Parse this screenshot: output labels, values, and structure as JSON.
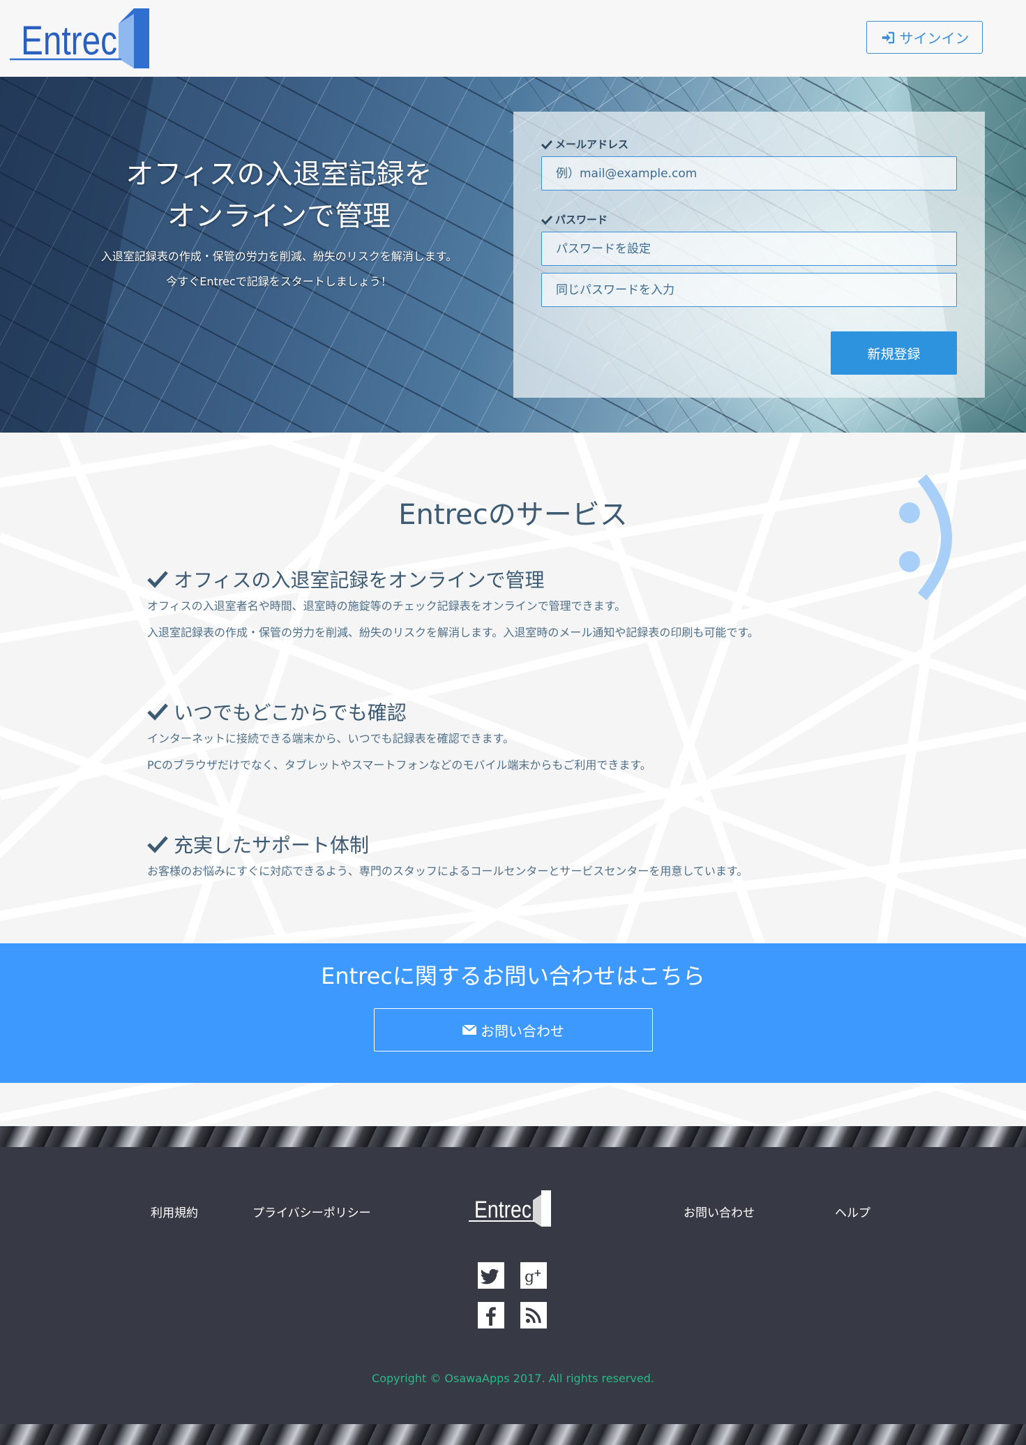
{
  "header": {
    "logo_text": "Entrec",
    "signin_label": "サインイン"
  },
  "hero": {
    "title_line1": "オフィスの入退室記録を",
    "title_line2": "オンラインで管理",
    "subtitle_line1": "入退室記録表の作成・保管の労力を削減、紛失のリスクを解消します。",
    "subtitle_line2": "今すぐEntrecで記録をスタートしましょう！"
  },
  "signup_form": {
    "email_label": "メールアドレス",
    "email_placeholder": "例）mail@example.com",
    "password_label": "パスワード",
    "password_placeholder": "パスワードを設定",
    "password_confirm_placeholder": "同じパスワードを入力",
    "register_label": "新規登録"
  },
  "services": {
    "title": "Entrecのサービス",
    "features": [
      {
        "heading": "オフィスの入退室記録をオンラインで管理",
        "lines": [
          "オフィスの入退室者名や時間、退室時の施錠等のチェック記録表をオンラインで管理できます。",
          "入退室記録表の作成・保管の労力を削減、紛失のリスクを解消します。入退室時のメール通知や記録表の印刷も可能です。"
        ]
      },
      {
        "heading": "いつでもどこからでも確認",
        "lines": [
          "インターネットに接続できる端末から、いつでも記録表を確認できます。",
          "PCのブラウザだけでなく、タブレットやスマートフォンなどのモバイル端末からもご利用できます。"
        ]
      },
      {
        "heading": "充実したサポート体制",
        "lines": [
          "お客様のお悩みにすぐに対応できるよう、専門のスタッフによるコールセンターとサービスセンターを用意しています。"
        ]
      }
    ]
  },
  "contact": {
    "title": "Entrecに関するお問い合わせはこちら",
    "button_label": "お問い合わせ"
  },
  "footer": {
    "links": {
      "terms": "利用規約",
      "privacy": "プライバシーポリシー",
      "contact": "お問い合わせ",
      "help": "ヘルプ"
    },
    "logo_text": "Entrec",
    "social": [
      "twitter-icon",
      "google-plus-icon",
      "facebook-icon",
      "rss-icon"
    ],
    "copyright": "Copyright © OsawaApps 2017. All rights reserved."
  },
  "colors": {
    "brand_blue": "#3d99fe",
    "button_blue": "#2d93de",
    "footer_bg": "#373a44",
    "copyright_green": "#2bb789",
    "text_dark": "#3d5a73"
  }
}
